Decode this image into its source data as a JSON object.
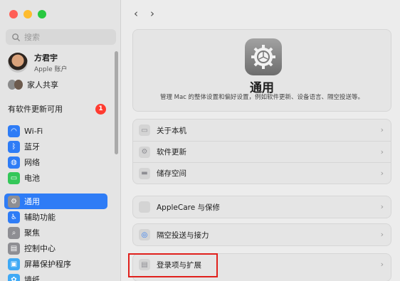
{
  "sidebar": {
    "search_placeholder": "搜索",
    "profile": {
      "name": "方君宇",
      "sub": "Apple 账户"
    },
    "family_label": "家人共享",
    "update_label": "有软件更新可用",
    "update_badge": "1",
    "items": [
      {
        "label": "Wi-Fi",
        "icon": "wifi-icon",
        "color": "#2e7cf6",
        "glyph": "◠"
      },
      {
        "label": "蓝牙",
        "icon": "bluetooth-icon",
        "color": "#2e7cf6",
        "glyph": "ᛒ"
      },
      {
        "label": "网络",
        "icon": "globe-icon",
        "color": "#2e7cf6",
        "glyph": "◍"
      },
      {
        "label": "电池",
        "icon": "battery-icon",
        "color": "#34c759",
        "glyph": "▭"
      },
      {
        "label": "通用",
        "icon": "gear-icon",
        "color": "#8e8e93",
        "glyph": "⚙"
      },
      {
        "label": "辅助功能",
        "icon": "accessibility-icon",
        "color": "#2e7cf6",
        "glyph": "♿"
      },
      {
        "label": "聚焦",
        "icon": "spotlight-icon",
        "color": "#8e8e93",
        "glyph": "⌕"
      },
      {
        "label": "控制中心",
        "icon": "control-center-icon",
        "color": "#8e8e93",
        "glyph": "▤"
      },
      {
        "label": "屏幕保护程序",
        "icon": "screensaver-icon",
        "color": "#3fa9f5",
        "glyph": "▣"
      },
      {
        "label": "墙纸",
        "icon": "wallpaper-icon",
        "color": "#3fa9f5",
        "glyph": "✿"
      }
    ]
  },
  "main": {
    "back_arrow": "‹",
    "forward_arrow": "›",
    "title": "通用",
    "description": "管理 Mac 的整体设置和偏好设置，例如软件更新、设备语言、隔空投送等。",
    "group1": [
      {
        "label": "关于本机",
        "icon": "laptop-icon",
        "glyph": "▭",
        "color": "#8e8e93"
      },
      {
        "label": "软件更新",
        "icon": "software-update-icon",
        "glyph": "⚙",
        "color": "#8e8e93"
      },
      {
        "label": "储存空间",
        "icon": "storage-icon",
        "glyph": "▬",
        "color": "#8e8e93"
      }
    ],
    "group2": [
      {
        "label": "AppleCare 与保修",
        "icon": "apple-icon",
        "glyph": "",
        "color": "#e0201c"
      }
    ],
    "group3": [
      {
        "label": "隔空投送与接力",
        "icon": "airdrop-icon",
        "glyph": "◎",
        "color": "#2e7cf6"
      }
    ],
    "group4": [
      {
        "label": "登录项与扩展",
        "icon": "login-items-icon",
        "glyph": "▤",
        "color": "#8e8e93"
      }
    ],
    "chevron": "›"
  }
}
